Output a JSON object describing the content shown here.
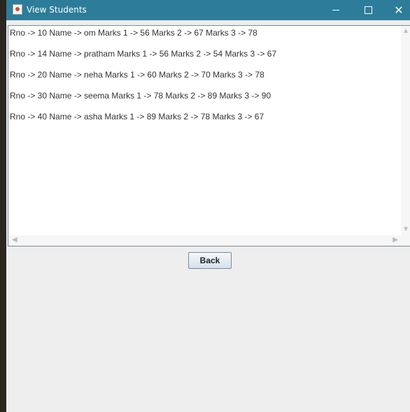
{
  "window": {
    "title": "View Students",
    "controls": {
      "minimize": "minimize-icon",
      "maximize": "maximize-icon",
      "close": "close-icon"
    }
  },
  "students": [
    "Rno -> 10 Name -> om Marks 1 -> 56 Marks 2 -> 67 Marks 3 -> 78",
    "Rno -> 14 Name -> pratham Marks 1 -> 56 Marks 2 -> 54 Marks 3 -> 67",
    "Rno -> 20 Name -> neha Marks 1 -> 60 Marks 2 -> 70 Marks 3 -> 78",
    "Rno -> 30 Name -> seema Marks 1 -> 78 Marks 2 -> 89 Marks 3 -> 90",
    "Rno -> 40 Name -> asha Marks 1 -> 89 Marks 2 -> 78 Marks 3 -> 67"
  ],
  "buttons": {
    "back": "Back"
  },
  "colors": {
    "titlebar": "#2d7d9a",
    "background": "#eeeeee",
    "text": "#333333"
  }
}
